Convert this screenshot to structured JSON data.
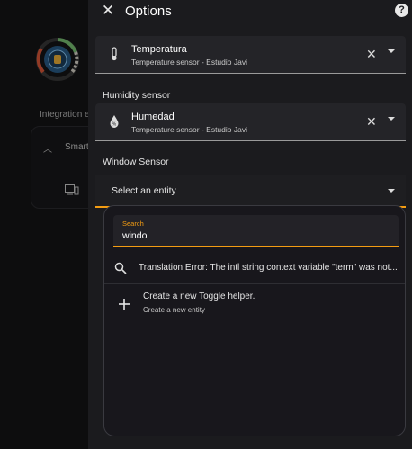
{
  "background": {
    "integration_label": "Integration e",
    "card_label": "Smart"
  },
  "dialog": {
    "title": "Options",
    "help_icon_text": "?",
    "temperature_field": {
      "name": "Temperatura",
      "sub": "Temperature sensor - Estudio Javi"
    },
    "humidity_section_label": "Humidity sensor",
    "humidity_field": {
      "name": "Humedad",
      "sub": "Temperature sensor - Estudio Javi"
    },
    "window_section_label": "Window Sensor",
    "window_select_placeholder": "Select an entity"
  },
  "popup": {
    "search_label": "Search",
    "search_value": "windo",
    "results": [
      {
        "text": "Translation Error: The intl string context variable \"term\" was not...",
        "icon": "search-icon"
      },
      {
        "text": "Create a new Toggle helper.",
        "sub": "Create a new entity",
        "icon": "plus-icon"
      }
    ]
  },
  "colors": {
    "accent": "#f39c12",
    "dialog_bg": "#1b1b1e",
    "page_bg": "#141416"
  }
}
